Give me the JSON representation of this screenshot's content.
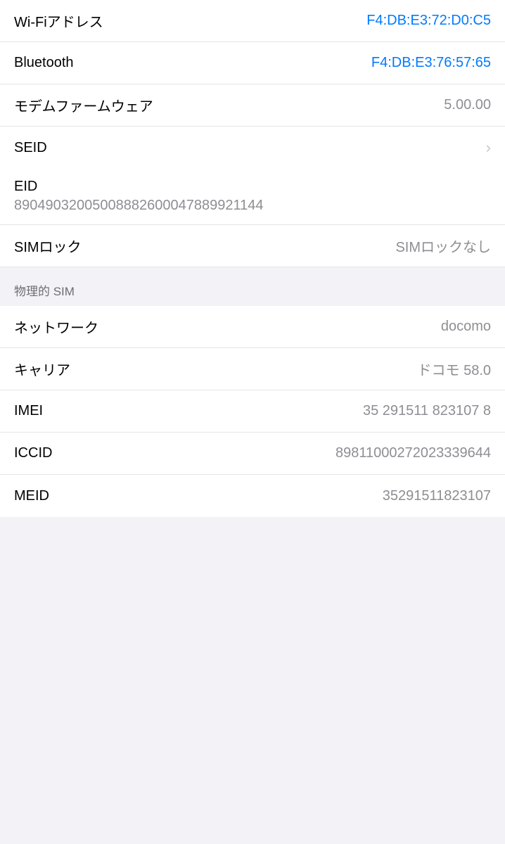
{
  "rows": [
    {
      "id": "wifi-address",
      "label": "Wi-Fiアドレス",
      "value": "F4:DB:E3:72:D0:C5",
      "type": "normal",
      "valueColor": "blue"
    },
    {
      "id": "bluetooth",
      "label": "Bluetooth",
      "value": "F4:DB:E3:76:57:65",
      "type": "normal",
      "valueColor": "blue"
    },
    {
      "id": "modem-firmware",
      "label": "モデムファームウェア",
      "value": "5.00.00",
      "type": "normal",
      "valueColor": "gray"
    },
    {
      "id": "seid",
      "label": "SEID",
      "value": "",
      "type": "chevron"
    }
  ],
  "eid": {
    "label": "EID",
    "value": "89049032005008882600047889921144"
  },
  "sim_lock": {
    "label": "SIMロック",
    "value": "SIMロックなし"
  },
  "section_header": {
    "label": "物理的 SIM"
  },
  "physical_sim_rows": [
    {
      "id": "network",
      "label": "ネットワーク",
      "value": "docomo",
      "valueColor": "gray"
    },
    {
      "id": "carrier",
      "label": "キャリア",
      "value": "ドコモ 58.0",
      "valueColor": "gray"
    },
    {
      "id": "imei",
      "label": "IMEI",
      "value": "35 291511 823107 8",
      "valueColor": "gray"
    },
    {
      "id": "iccid",
      "label": "ICCID",
      "value": "89811000272023339644",
      "valueColor": "gray"
    },
    {
      "id": "meid",
      "label": "MEID",
      "value": "35291511823107",
      "valueColor": "gray"
    }
  ],
  "colors": {
    "blue": "#007aff",
    "gray": "#8e8e93",
    "divider": "#e5e5ea",
    "background": "#f2f2f7"
  }
}
